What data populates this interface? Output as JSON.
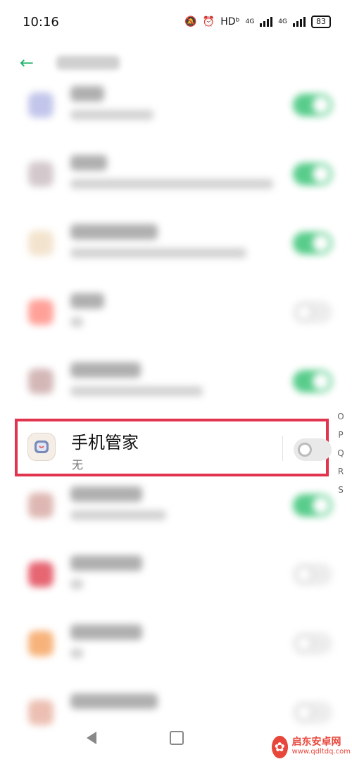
{
  "status_bar": {
    "time": "10:16",
    "network": "HDᵇ",
    "signal1": "4G",
    "signal2": "4G",
    "battery": "83"
  },
  "highlighted_item": {
    "title": "手机管家",
    "subtitle": "无",
    "toggle_state": "off"
  },
  "index_letters": [
    "O",
    "P",
    "Q",
    "R",
    "S"
  ],
  "watermark": {
    "main": "启东安卓网",
    "url": "www.qdltdq.com"
  },
  "colors": {
    "accent_green": "#2fc06e",
    "highlight_red": "#e0344f"
  },
  "blurred_rows": [
    {
      "icon_color": "#b4b8e6",
      "toggle": "on"
    },
    {
      "icon_color": "#c9bcc0",
      "toggle": "on"
    },
    {
      "icon_color": "#f0ddc2",
      "toggle": "on"
    },
    {
      "icon_color": "#ff8a80",
      "toggle": "off"
    },
    {
      "icon_color": "#c9a6a6",
      "toggle": "on"
    },
    {
      "icon_color": "#d6a6a0",
      "toggle": "on"
    },
    {
      "icon_color": "#e04050",
      "toggle": "off"
    },
    {
      "icon_color": "#f5a05a",
      "toggle": "off"
    },
    {
      "icon_color": "#e8b0a0",
      "toggle": "off"
    }
  ]
}
